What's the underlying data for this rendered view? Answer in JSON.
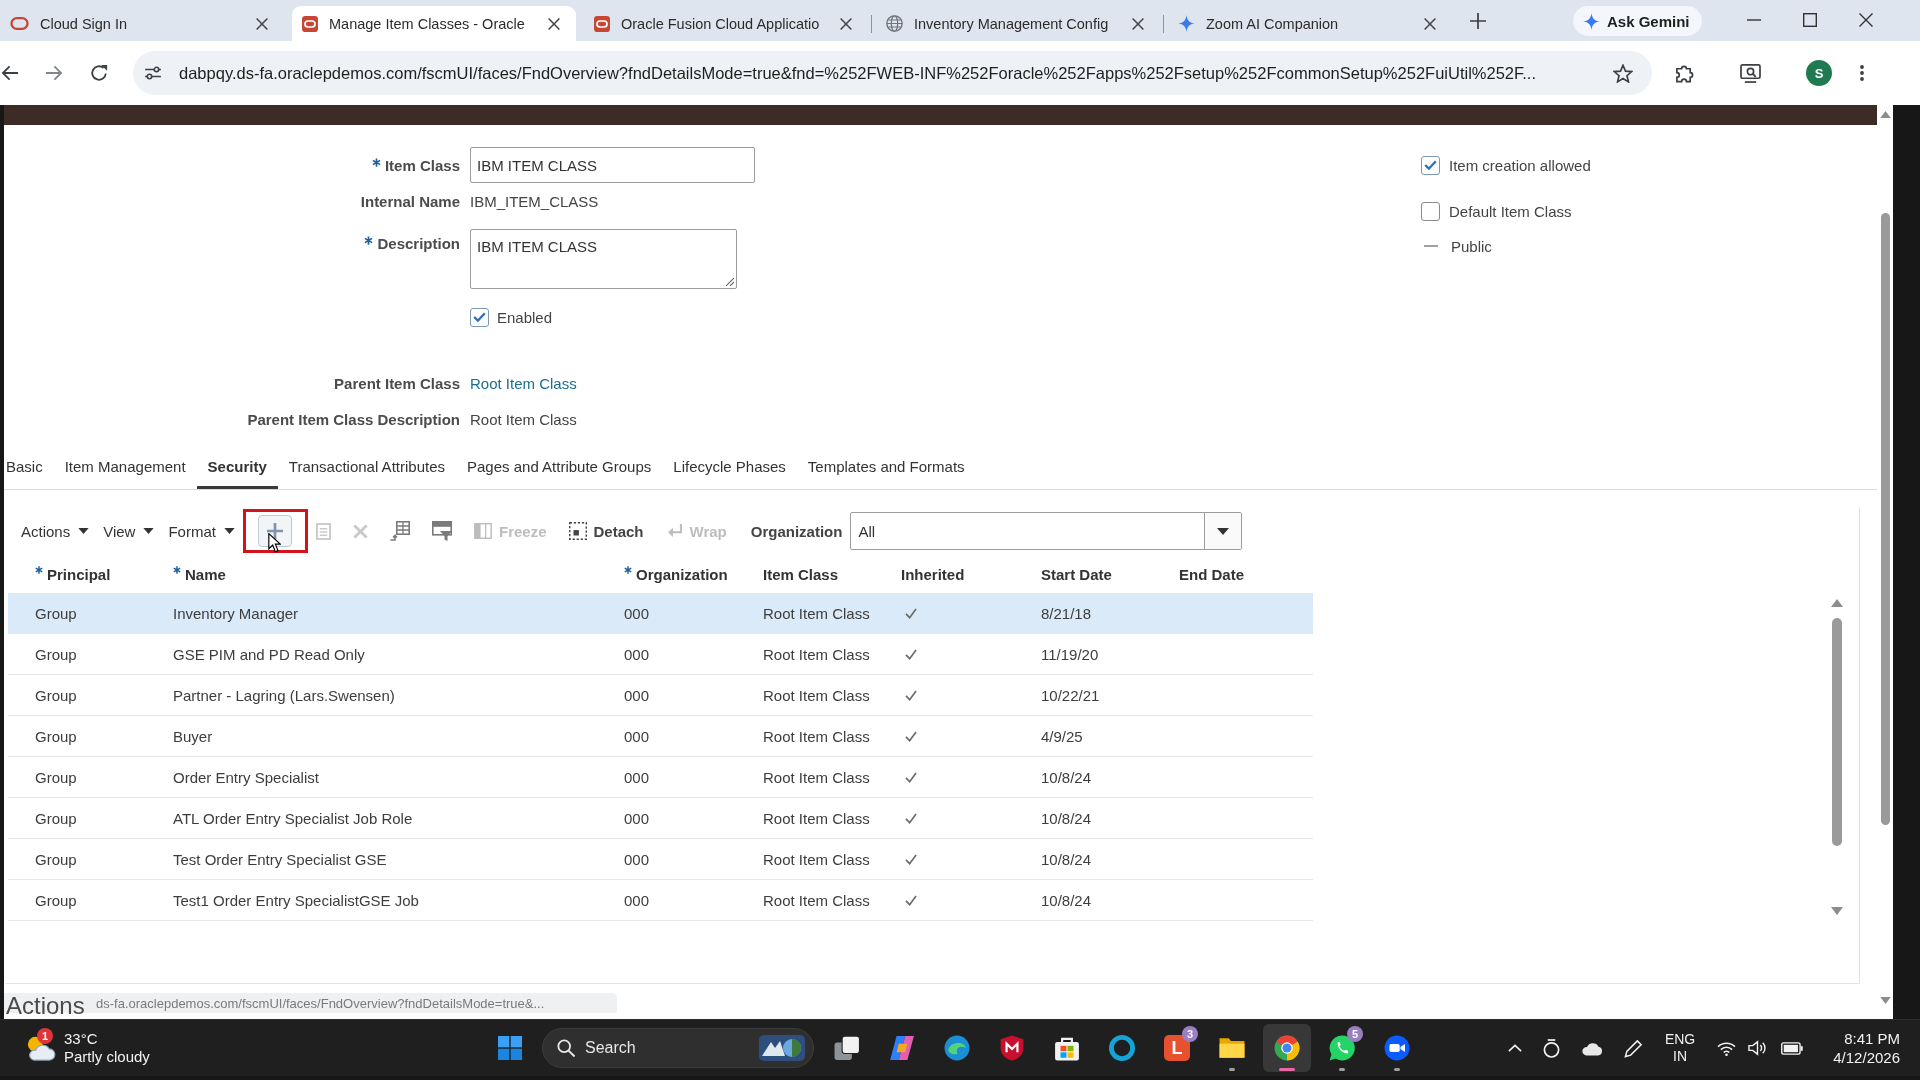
{
  "browser": {
    "tabs": [
      {
        "kind": "oracle-outline",
        "title": "Cloud Sign In",
        "selected": false
      },
      {
        "kind": "oracle",
        "title": "Manage Item Classes - Oracle",
        "selected": true
      },
      {
        "kind": "oracle",
        "title": "Oracle Fusion Cloud Applicatio",
        "selected": false
      },
      {
        "kind": "globe",
        "title": "Inventory Management Config",
        "selected": false
      },
      {
        "kind": "sparkle",
        "title": "Zoom AI Companion",
        "selected": false
      }
    ],
    "gemini_button": "Ask Gemini",
    "address": "dabpqy.ds-fa.oraclepdemos.com/fscmUI/faces/FndOverview?fndDetailsMode=true&fnd=%252FWEB-INF%252Foracle%252Fapps%252Fsetup%252FcommonSetup%252FuiUtil%252F...",
    "profile_initial": "S"
  },
  "form": {
    "fields": [
      {
        "kind": "input",
        "label": "Item Class",
        "required": true,
        "value": "IBM ITEM CLASS"
      },
      {
        "kind": "text",
        "label": "Internal Name",
        "required": false,
        "value": "IBM_ITEM_CLASS"
      },
      {
        "kind": "textarea",
        "label": "Description",
        "required": true,
        "value": "IBM ITEM CLASS"
      },
      {
        "kind": "checkbox",
        "label": "Enabled",
        "checked": true
      },
      {
        "kind": "link",
        "label": "Parent Item Class",
        "required": false,
        "value": "Root Item Class"
      },
      {
        "kind": "text",
        "label": "Parent Item Class Description",
        "required": false,
        "value": "Root Item Class"
      }
    ],
    "options": [
      {
        "kind": "checkbox",
        "label": "Item creation allowed",
        "checked": true
      },
      {
        "kind": "checkbox",
        "label": "Default Item Class",
        "checked": false
      },
      {
        "kind": "readonly",
        "label": "Public",
        "checked": false
      }
    ]
  },
  "tabs": [
    {
      "label": "Basic",
      "selected": false
    },
    {
      "label": "Item Management",
      "selected": false
    },
    {
      "label": "Security",
      "selected": true
    },
    {
      "label": "Transactional Attributes",
      "selected": false
    },
    {
      "label": "Pages and Attribute Groups",
      "selected": false
    },
    {
      "label": "Lifecycle Phases",
      "selected": false
    },
    {
      "label": "Templates and Formats",
      "selected": false
    }
  ],
  "toolbar": {
    "menus": [
      "Actions",
      "View",
      "Format"
    ],
    "buttons": [
      {
        "kind": "add",
        "disabled": false,
        "highlighted": true
      },
      {
        "kind": "edit",
        "disabled": true,
        "highlighted": false
      },
      {
        "kind": "delete",
        "disabled": true,
        "highlighted": false
      },
      {
        "kind": "insert",
        "disabled": false,
        "highlighted": false
      },
      {
        "kind": "query",
        "disabled": false,
        "highlighted": false
      },
      {
        "kind": "freeze",
        "label": "Freeze",
        "disabled": true,
        "highlighted": false
      },
      {
        "kind": "detach",
        "label": "Detach",
        "disabled": false,
        "highlighted": false
      },
      {
        "kind": "wrap",
        "label": "Wrap",
        "disabled": true,
        "highlighted": false
      }
    ],
    "organization": {
      "label": "Organization",
      "value": "All"
    }
  },
  "table": {
    "columns": [
      {
        "label": "Principal",
        "required": true
      },
      {
        "label": "Name",
        "required": true
      },
      {
        "label": "Organization",
        "required": true
      },
      {
        "label": "Item Class",
        "required": false
      },
      {
        "label": "Inherited",
        "required": false
      },
      {
        "label": "Start Date",
        "required": false
      },
      {
        "label": "End Date",
        "required": false
      }
    ],
    "rows": [
      {
        "principal": "Group",
        "name": "Inventory Manager",
        "organization": "000",
        "item_class": "Root Item Class",
        "inherited": true,
        "start_date": "8/21/18",
        "selected": true
      },
      {
        "principal": "Group",
        "name": "GSE PIM and PD Read Only",
        "organization": "000",
        "item_class": "Root Item Class",
        "inherited": true,
        "start_date": "11/19/20",
        "selected": false
      },
      {
        "principal": "Group",
        "name": "Partner - Lagring (Lars.Swensen)",
        "organization": "000",
        "item_class": "Root Item Class",
        "inherited": true,
        "start_date": "10/22/21",
        "selected": false
      },
      {
        "principal": "Group",
        "name": "Buyer",
        "organization": "000",
        "item_class": "Root Item Class",
        "inherited": true,
        "start_date": "4/9/25",
        "selected": false
      },
      {
        "principal": "Group",
        "name": "Order Entry Specialist",
        "organization": "000",
        "item_class": "Root Item Class",
        "inherited": true,
        "start_date": "10/8/24",
        "selected": false
      },
      {
        "principal": "Group",
        "name": "ATL Order Entry Specialist Job Role",
        "organization": "000",
        "item_class": "Root Item Class",
        "inherited": true,
        "start_date": "10/8/24",
        "selected": false
      },
      {
        "principal": "Group",
        "name": "Test Order Entry Specialist GSE",
        "organization": "000",
        "item_class": "Root Item Class",
        "inherited": true,
        "start_date": "10/8/24",
        "selected": false
      },
      {
        "principal": "Group",
        "name": "Test1 Order Entry SpecialistGSE Job",
        "organization": "000",
        "item_class": "Root Item Class",
        "inherited": true,
        "start_date": "10/8/24",
        "selected": false
      }
    ]
  },
  "status_bar": {
    "tooltip": "Actions",
    "url": "ds-fa.oraclepdemos.com/fscmUI/faces/FndOverview?fndDetailsMode=true&..."
  },
  "taskbar": {
    "weather": {
      "badge": "1",
      "temperature": "33°C",
      "condition": "Partly cloudy"
    },
    "search": "Search",
    "apps": [
      {
        "kind": "task-view",
        "running": false,
        "active": false
      },
      {
        "kind": "copilot",
        "running": false,
        "active": false
      },
      {
        "kind": "edge",
        "running": false,
        "active": false
      },
      {
        "kind": "mcafee",
        "running": false,
        "active": false
      },
      {
        "kind": "store",
        "running": false,
        "active": false
      },
      {
        "kind": "alexa",
        "running": false,
        "active": false
      },
      {
        "kind": "letter",
        "label": "L",
        "badge": "3",
        "running": false,
        "active": false
      },
      {
        "kind": "explorer",
        "running": true,
        "active": false
      },
      {
        "kind": "chrome",
        "running": true,
        "active": true
      },
      {
        "kind": "whatsapp",
        "badge": "5",
        "running": true,
        "active": false
      },
      {
        "kind": "zoom",
        "running": true,
        "active": false
      }
    ],
    "language": "ENG",
    "region": "IN",
    "time": "8:41 PM",
    "date": "4/12/2026"
  }
}
